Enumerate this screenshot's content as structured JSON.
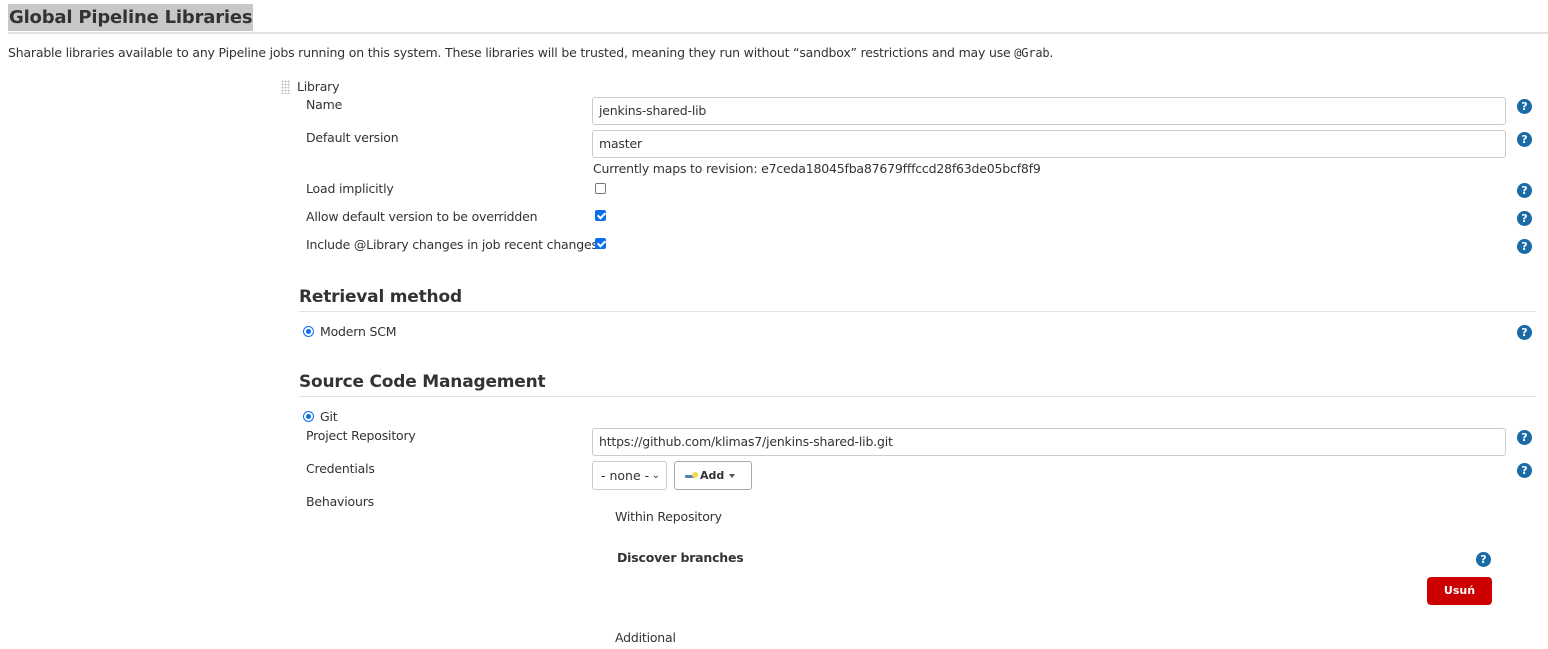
{
  "header": {
    "title": "Global Pipeline Libraries",
    "description_before_code": "Sharable libraries available to any Pipeline jobs running on this system. These libraries will be trusted, meaning they run without “sandbox” restrictions and may use ",
    "description_code": "@Grab",
    "description_after_code": "."
  },
  "library": {
    "label": "Library",
    "name": {
      "label": "Name",
      "value": "jenkins-shared-lib"
    },
    "default_version": {
      "label": "Default version",
      "value": "master",
      "revision_note": "Currently maps to revision: e7ceda18045fba87679fffccd28f63de05bcf8f9"
    },
    "load_implicitly": {
      "label": "Load implicitly",
      "checked": false
    },
    "allow_override": {
      "label": "Allow default version to be overridden",
      "checked": true
    },
    "include_changes": {
      "label": "Include @Library changes in job recent changes",
      "checked": true
    }
  },
  "retrieval": {
    "heading": "Retrieval method",
    "option": {
      "label": "Modern SCM",
      "selected": true
    }
  },
  "scm": {
    "heading": "Source Code Management",
    "option": {
      "label": "Git",
      "selected": true
    },
    "project_repository": {
      "label": "Project Repository",
      "value": "https://github.com/klimas7/jenkins-shared-lib.git"
    },
    "credentials": {
      "label": "Credentials",
      "selected": "- none -",
      "add_label": "Add"
    },
    "behaviours": {
      "label": "Behaviours",
      "group": "Within Repository",
      "item": "Discover branches",
      "delete_label": "Usuń",
      "additional": "Additional"
    }
  },
  "icons": {
    "help": "?",
    "chevron": "⌄"
  },
  "colors": {
    "accent": "#0a6ef0",
    "help": "#1a6aa5",
    "danger": "#cc0000"
  }
}
